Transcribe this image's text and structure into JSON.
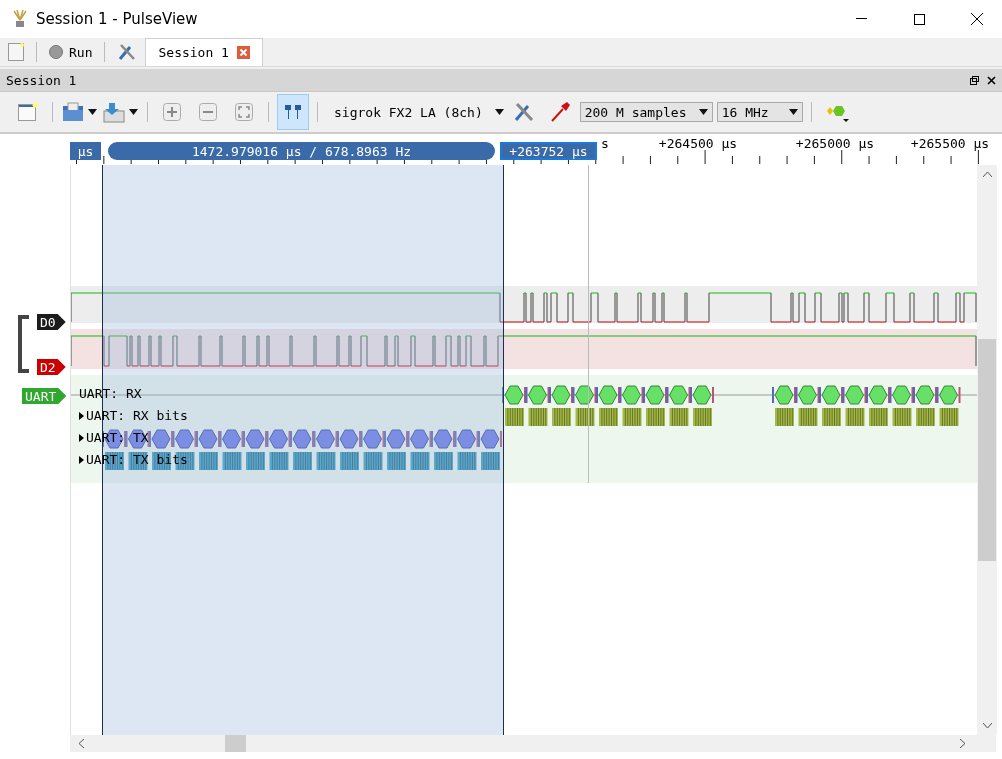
{
  "window": {
    "title": "Session 1 - PulseView"
  },
  "main_toolbar": {
    "run_label": "Run",
    "tabs": [
      {
        "label": "Session 1",
        "selected": true
      }
    ]
  },
  "session_dock": {
    "title": "Session 1"
  },
  "toolbar": {
    "device": "sigrok FX2 LA (8ch)",
    "sample_count": "200 M samples",
    "sample_rate": "16 MHz",
    "cursor_toggle_on": true
  },
  "ruler": {
    "left_marker": "μs",
    "measurement": "1472.979016 μs / 678.8963 Hz",
    "cursor": "+263752 μs",
    "labels": [
      "s",
      "+264500 μs",
      "+265000 μs",
      "+265500 μs"
    ]
  },
  "channels": [
    {
      "name": "D0",
      "color": "#1c1c1c"
    },
    {
      "name": "D2",
      "color": "#cc0000"
    }
  ],
  "decoder": {
    "name": "UART",
    "color": "#2ea82e",
    "rows": [
      {
        "label": "UART: RX",
        "show_toggle": false
      },
      {
        "label": "UART: RX bits",
        "show_toggle": true
      },
      {
        "label": "UART: TX",
        "show_toggle": true
      },
      {
        "label": "UART: TX bits",
        "show_toggle": true
      }
    ]
  }
}
